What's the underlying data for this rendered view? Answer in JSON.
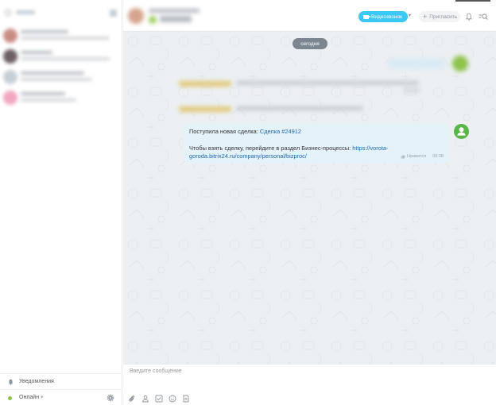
{
  "sidebar": {
    "notifications_label": "Уведомления",
    "status_label": "Онлайн",
    "status_caret": "▾",
    "status_color": "#8ec24a",
    "icons": {
      "search": "search-icon",
      "compose": "pencil-icon",
      "bell": "bell-icon",
      "settings": "gear-icon"
    }
  },
  "header": {
    "video_call_label": "Видеозвонок",
    "video_caret": "▾",
    "invite_label": "Пригласить",
    "invite_prefix": "+",
    "accent_color": "#3bc8f5"
  },
  "chat": {
    "date_label": "сегодня",
    "message": {
      "line1_prefix": "Поступила новая сделка: ",
      "deal_link": "Сделка #24912",
      "line2_prefix": "Чтобы взять сделку, перейдите в раздел Бизнес-процессы: ",
      "bp_link": "https://vorota-goroda.bitrix24.ru/company/personal/bizproc/",
      "like_label": "Нравится",
      "time": "09:38"
    },
    "bubble_color": "#e4f2fa",
    "link_color": "#2067b0"
  },
  "composer": {
    "placeholder": "Введите сообщение",
    "toolbar_icons": [
      "paperclip-icon",
      "user-icon",
      "checkbox-icon",
      "smile-icon",
      "document-icon"
    ]
  }
}
